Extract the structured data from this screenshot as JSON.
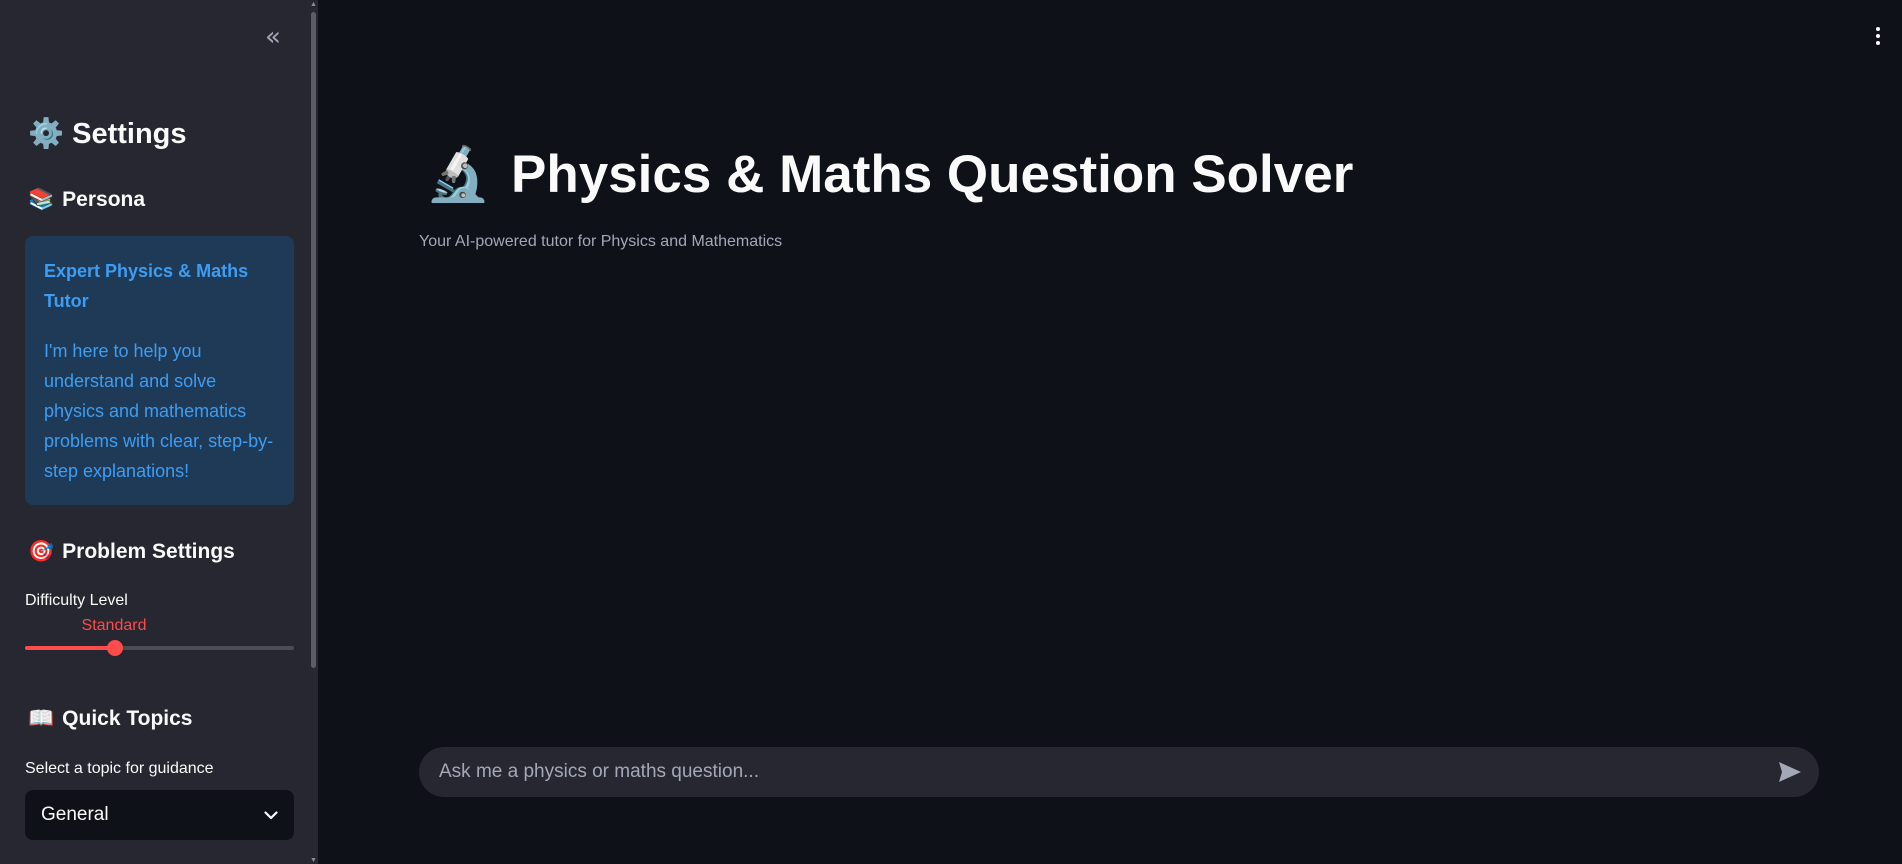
{
  "sidebar": {
    "collapse_icon": "double-chevron-left-icon",
    "settings": {
      "icon": "⚙️",
      "title": "Settings"
    },
    "persona": {
      "icon": "📚",
      "heading": "Persona",
      "card_title": "Expert Physics & Maths Tutor",
      "card_text": "I'm here to help you understand and solve physics and mathematics problems with clear, step-by-step explanations!"
    },
    "problem_settings": {
      "icon": "🎯",
      "heading": "Problem Settings",
      "difficulty_label": "Difficulty Level",
      "difficulty_value": "Standard",
      "difficulty_fraction": 0.333
    },
    "quick_topics": {
      "icon": "📖",
      "heading": "Quick Topics",
      "select_label": "Select a topic for guidance",
      "selected_topic": "General"
    }
  },
  "main": {
    "menu_icon": "kebab-menu-icon",
    "title_icon": "🔬",
    "title": "Physics & Maths Question Solver",
    "subtitle": "Your AI-powered tutor for Physics and Mathematics",
    "chat_placeholder": "Ask me a physics or maths question..."
  },
  "colors": {
    "sidebar_bg": "#262730",
    "main_bg": "#0e1117",
    "accent": "#ff4b4b",
    "info_bg": "#1f3a57",
    "info_text": "#3d9df3"
  }
}
